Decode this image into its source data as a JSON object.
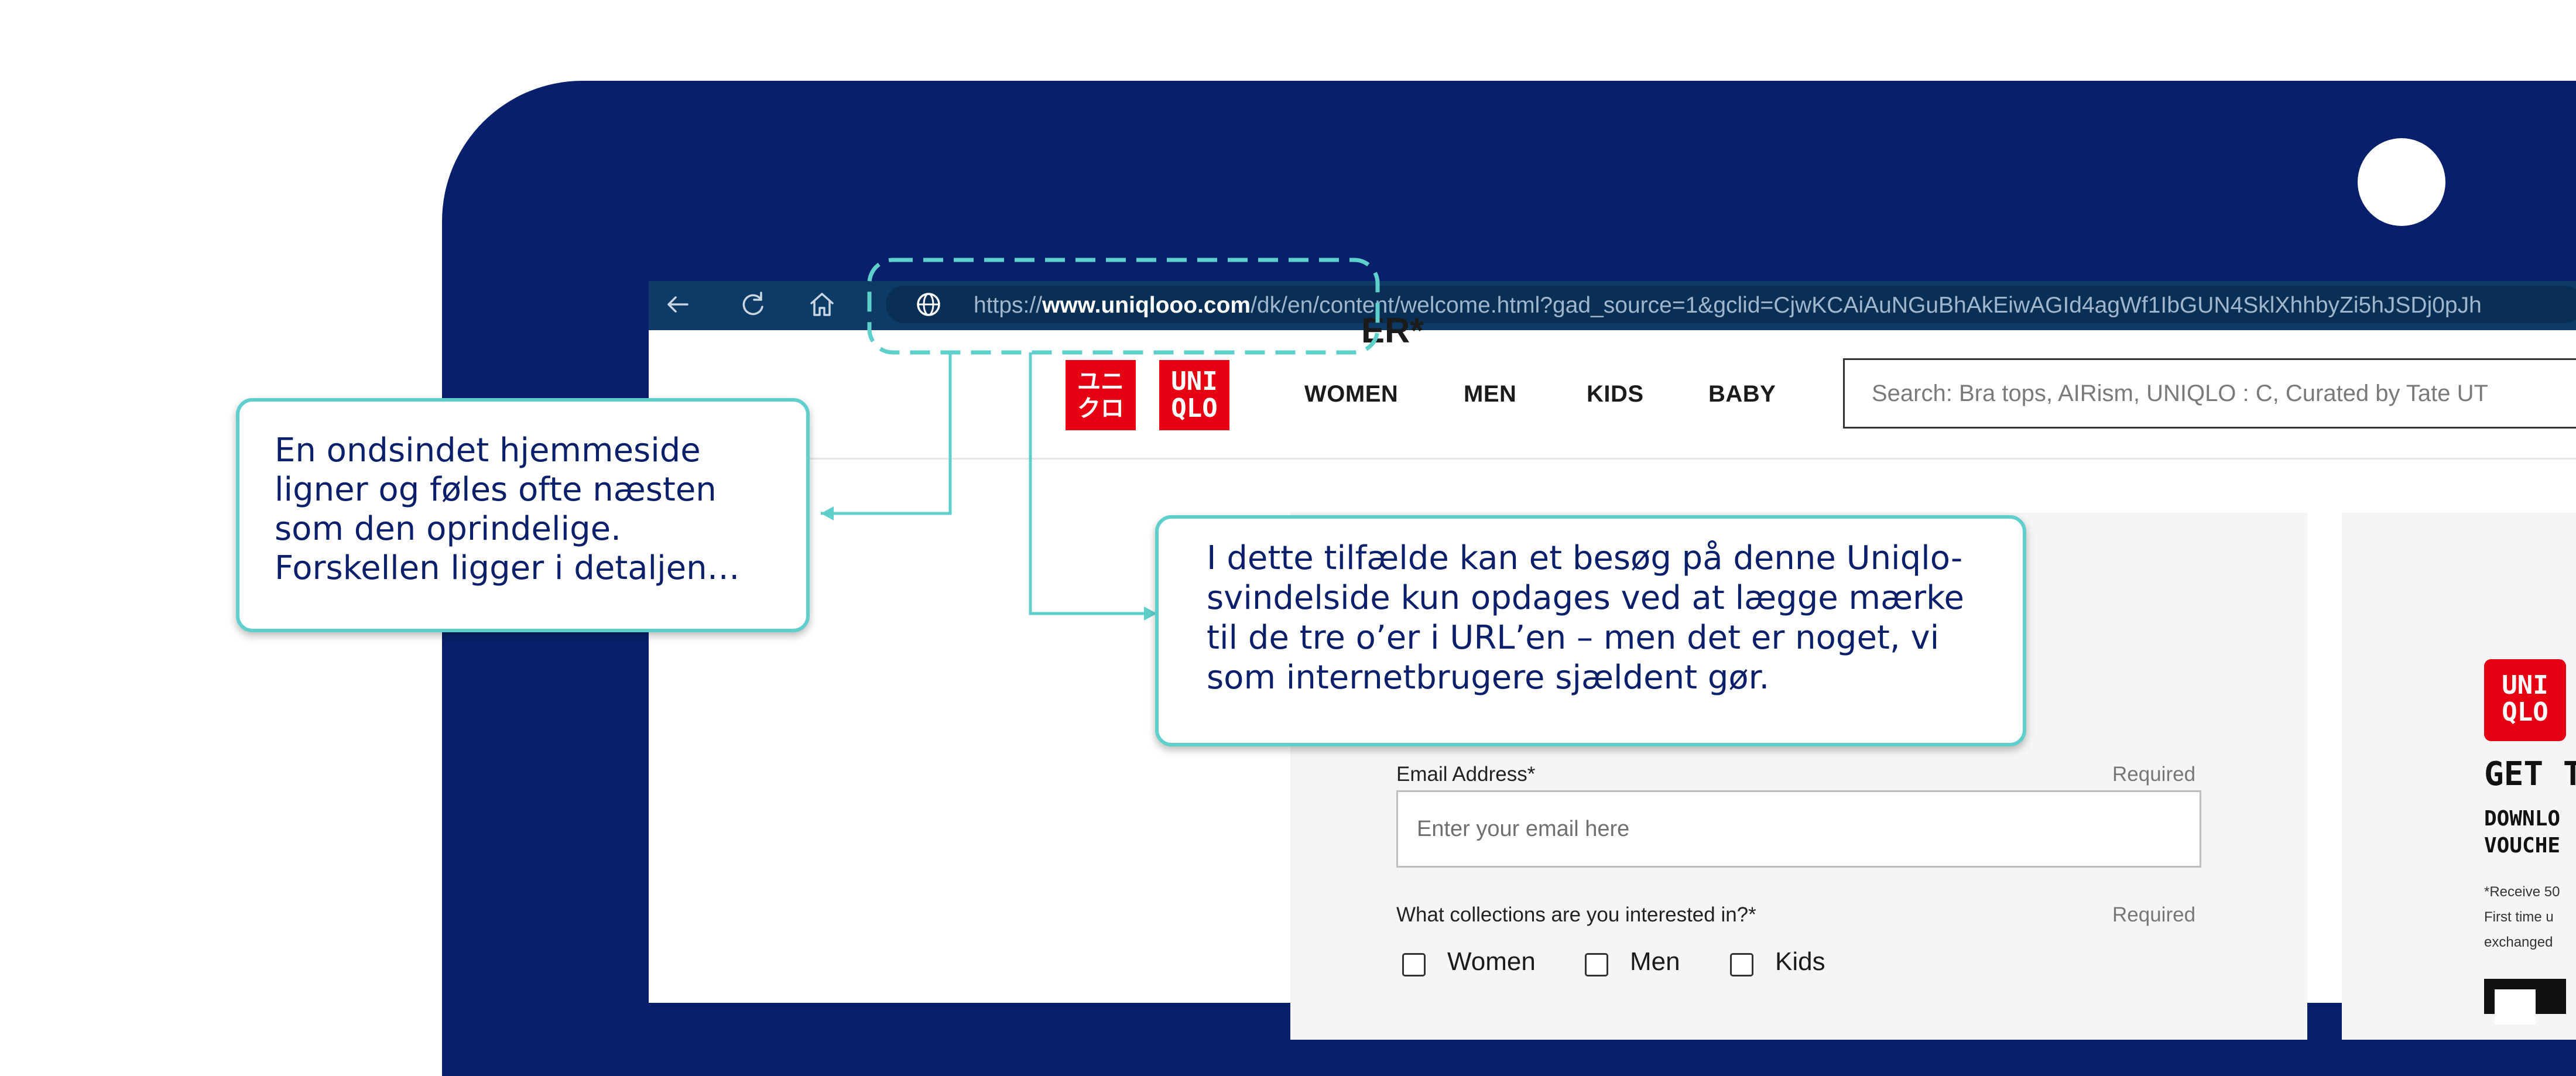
{
  "browser": {
    "url_scheme": "https://",
    "url_domain": "www.uniqlooo.com",
    "url_path": "/dk/en/content/welcome.html?gad_source=1&gclid=CjwKCAiAuNGuBhAkEiwAGId4agWf1IbGUN4SklXhhbyZi5hJSDj0pJh"
  },
  "site": {
    "logo_glyph": "ユニ\nクロ",
    "logo_text": "UNI\nQLO",
    "nav": [
      "WOMEN",
      "MEN",
      "KIDS",
      "BABY"
    ],
    "search_placeholder": "Search: Bra tops, AIRism, UNIQLO : C, Curated by Tate UT"
  },
  "form": {
    "title_fragment": "ER*",
    "email_label": "Email Address*",
    "email_required": "Required",
    "email_placeholder": "Enter your email here",
    "collections_label": "What collections are you interested in?*",
    "collections_required": "Required",
    "options": [
      "Women",
      "Men",
      "Kids"
    ]
  },
  "promo": {
    "logo_text": "UNI\nQLO",
    "title": "GET T",
    "sub1": "DOWNLO",
    "sub2": "VOUCHE",
    "small1": "*Receive 50",
    "small2": "First time u",
    "small3": "exchanged"
  },
  "callouts": {
    "left": "En ondsindet hjemmeside\nligner og føles ofte næsten\nsom den oprindelige.\nForskellen ligger i detaljen…",
    "right": "I dette tilfælde kan et besøg på denne Uniqlo-\nsvindelside kun opdages ved at lægge mærke\ntil de tre o’er i URL’en – men det er noget, vi\nsom internetbrugere sjældent gør."
  },
  "colors": {
    "device": "#08206b",
    "accent": "#5fcfcc",
    "brand_red": "#e60012",
    "callout_text": "#0b1f6b"
  },
  "icons": [
    "back-arrow-icon",
    "reload-icon",
    "home-icon",
    "globe-icon"
  ]
}
